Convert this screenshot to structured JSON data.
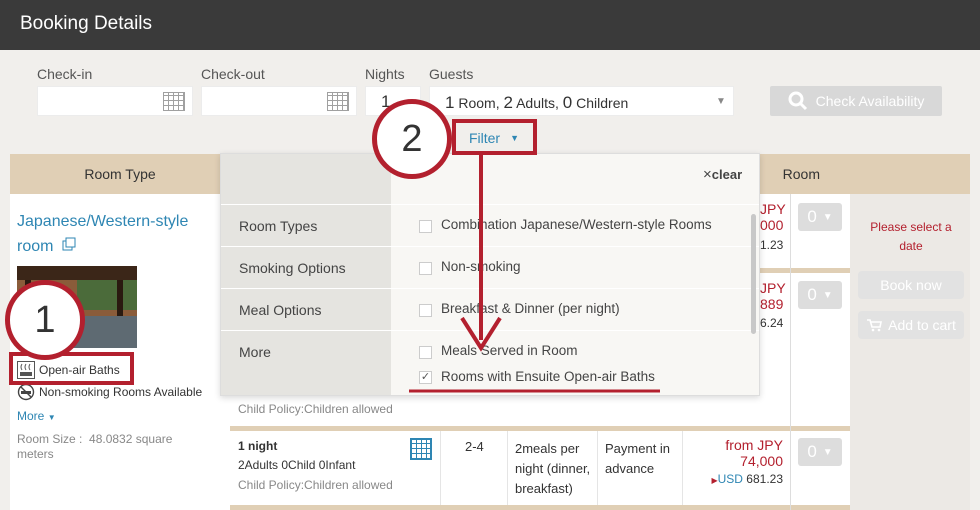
{
  "header": {
    "title": "Booking Details"
  },
  "search": {
    "checkin_label": "Check-in",
    "checkout_label": "Check-out",
    "nights_label": "Nights",
    "nights_value": "1",
    "guests_label": "Guests",
    "guests": {
      "rooms_n": "1",
      "rooms_word": " Room, ",
      "adults_n": "2",
      "adults_word": " Adults, ",
      "children_n": "0",
      "children_word": " Children"
    },
    "availability_button": "Check Availability"
  },
  "filter": {
    "label": "Filter",
    "clear": "clear",
    "categories": [
      "Room Types",
      "Smoking Options",
      "Meal Options",
      "More"
    ],
    "options": {
      "room_types": "Combination Japanese/Western-style Rooms",
      "smoking": "Non-smoking",
      "meals": "Breakfast & Dinner (per night)",
      "more1": "Meals Served in Room",
      "more2": "Rooms with Ensuite Open-air Baths"
    },
    "checked": "✓"
  },
  "table": {
    "col_room_type": "Room Type",
    "col_room": "Room"
  },
  "room": {
    "name_line1": "Japanese/Western-style",
    "name_line2": "room",
    "feature1": "Open-air Baths",
    "feature2": "Non-smoking Rooms Available",
    "more": "More",
    "size_label": "Room Size :",
    "size_value": "48.0832 square",
    "size_unit": "meters"
  },
  "plans": [
    {
      "price_a": "JPY",
      "price_b": "000",
      "usd": "1.23",
      "select": "0"
    },
    {
      "price_a": "JPY",
      "price_b": "889",
      "usd": "6.24",
      "select": "0"
    },
    {
      "child_policy": "Child Policy:Children allowed"
    },
    {
      "nights": "1 night",
      "guests": "2Adults 0Child 0Infant",
      "child_policy": "Child Policy:Children allowed",
      "capacity": "2-4",
      "meals_l1": "2meals per",
      "meals_l2": "night (dinner,",
      "meals_l3": "breakfast)",
      "pay_l1": "Payment in",
      "pay_l2": "advance",
      "price_l1": "from JPY",
      "price_l2": "74,000",
      "usd_label": "USD",
      "usd_value": "681.23",
      "select": "0"
    }
  ],
  "actions": {
    "please_select_l1": "Please select a",
    "please_select_l2": "date",
    "book_now": "Book now",
    "add_to_cart": "Add to cart"
  },
  "annotations": {
    "step1": "1",
    "step2": "2"
  },
  "colors": {
    "accent_red": "#b3202e",
    "link_blue": "#2e86b3",
    "header_bg": "#3a3a3a",
    "table_header": "#e0cfb5"
  }
}
